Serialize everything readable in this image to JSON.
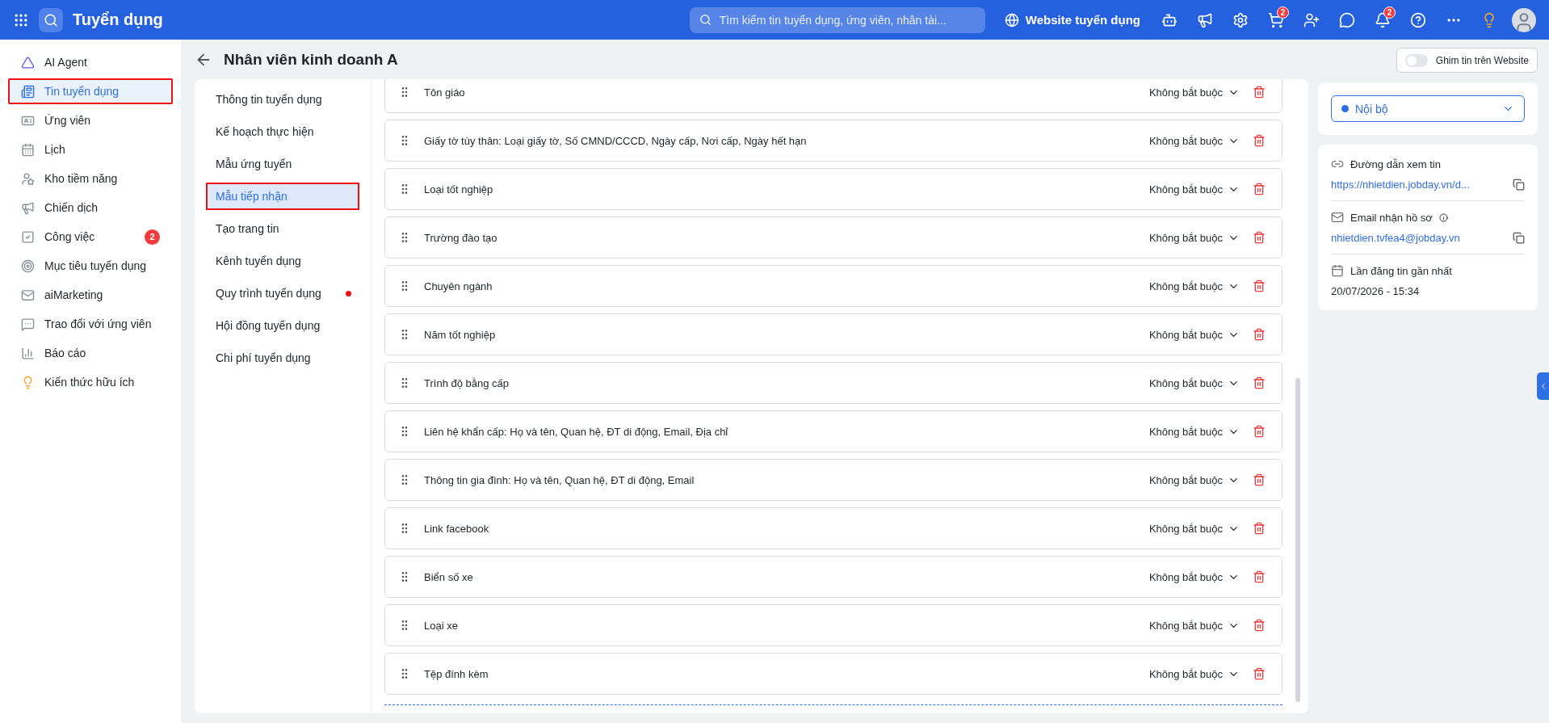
{
  "topbar": {
    "app_title": "Tuyển dụng",
    "search": {
      "placeholder": "Tìm kiếm tin tuyển dụng, ứng viên, nhân tài..."
    },
    "website_link": "Website tuyển dụng",
    "actions": [
      {
        "kind": "robot"
      },
      {
        "kind": "megaphone"
      },
      {
        "kind": "settings"
      },
      {
        "kind": "cart",
        "badge": "2"
      },
      {
        "kind": "add-user"
      },
      {
        "kind": "chat"
      },
      {
        "kind": "bell",
        "badge": "2"
      },
      {
        "kind": "help"
      },
      {
        "kind": "more"
      },
      {
        "kind": "bulb"
      },
      {
        "kind": "avatar"
      }
    ]
  },
  "sidebar": {
    "items": [
      {
        "kind": "agent",
        "label": "AI Agent",
        "selected": false
      },
      {
        "kind": "news",
        "label": "Tin tuyển dụng",
        "selected": true
      },
      {
        "kind": "card",
        "label": "Ứng viên",
        "selected": false
      },
      {
        "kind": "calendar",
        "label": "Lịch",
        "selected": false
      },
      {
        "kind": "talent",
        "label": "Kho tiềm năng",
        "selected": false
      },
      {
        "kind": "campaign",
        "label": "Chiến dịch",
        "selected": false
      },
      {
        "kind": "task",
        "label": "Công việc",
        "selected": false,
        "badge": "2"
      },
      {
        "kind": "target",
        "label": "Mục tiêu tuyển dụng",
        "selected": false
      },
      {
        "kind": "mail",
        "label": "aiMarketing",
        "selected": false
      },
      {
        "kind": "message",
        "label": "Trao đổi với ứng viên",
        "selected": false
      },
      {
        "kind": "chart",
        "label": "Báo cáo",
        "selected": false
      },
      {
        "kind": "bulb",
        "label": "Kiến thức hữu ích",
        "selected": false
      }
    ]
  },
  "page": {
    "title": "Nhân viên kinh doanh A"
  },
  "sub_nav": {
    "items": [
      {
        "label": "Thông tin tuyển dụng",
        "selected": false,
        "alert": false
      },
      {
        "label": "Kế hoạch thực hiện",
        "selected": false,
        "alert": false
      },
      {
        "label": "Mẫu ứng tuyển",
        "selected": false,
        "alert": false
      },
      {
        "label": "Mẫu tiếp nhận",
        "selected": true,
        "alert": false
      },
      {
        "label": "Tạo trang tin",
        "selected": false,
        "alert": false
      },
      {
        "label": "Kênh tuyển dụng",
        "selected": false,
        "alert": false
      },
      {
        "label": "Quy trình tuyển dụng",
        "selected": false,
        "alert": true
      },
      {
        "label": "Hội đồng tuyển dụng",
        "selected": false,
        "alert": false
      },
      {
        "label": "Chi phí tuyển dụng",
        "selected": false,
        "alert": false
      }
    ]
  },
  "fields": [
    {
      "label": "Tôn giáo",
      "requirement": "Không bắt buộc"
    },
    {
      "label": "Giấy tờ tùy thân: Loại giấy tờ, Số CMND/CCCD, Ngày cấp, Nơi cấp, Ngày hết hạn",
      "requirement": "Không bắt buộc"
    },
    {
      "label": "Loại tốt nghiệp",
      "requirement": "Không bắt buộc"
    },
    {
      "label": "Trường đào tạo",
      "requirement": "Không bắt buộc"
    },
    {
      "label": "Chuyên ngành",
      "requirement": "Không bắt buộc"
    },
    {
      "label": "Năm tốt nghiệp",
      "requirement": "Không bắt buộc"
    },
    {
      "label": "Trình độ bằng cấp",
      "requirement": "Không bắt buộc"
    },
    {
      "label": "Liên hệ khẩn cấp: Họ và tên, Quan hệ, ĐT di động, Email, Địa chỉ",
      "requirement": "Không bắt buộc"
    },
    {
      "label": "Thông tin gia đình: Họ và tên, Quan hệ, ĐT di động, Email",
      "requirement": "Không bắt buộc"
    },
    {
      "label": "Link facebook",
      "requirement": "Không bắt buộc"
    },
    {
      "label": "Biển số xe",
      "requirement": "Không bắt buộc"
    },
    {
      "label": "Loại xe",
      "requirement": "Không bắt buộc"
    },
    {
      "label": "Tệp đính kèm",
      "requirement": "Không bắt buộc"
    }
  ],
  "right_panel": {
    "pin_toggle": {
      "label": "Ghim tin trên Website",
      "on": false
    },
    "status": {
      "label": "Nội bộ",
      "color": "#2f6fe4"
    },
    "view_link": {
      "label": "Đường dẫn xem tin",
      "value": "https://nhietdien.jobday.vn/d..."
    },
    "email": {
      "label": "Email nhận hồ sơ",
      "value": "nhietdien.tvfea4@jobday.vn"
    },
    "last_post": {
      "label": "Lần đăng tin gần nhất",
      "value": "20/07/2026 - 15:34"
    }
  }
}
